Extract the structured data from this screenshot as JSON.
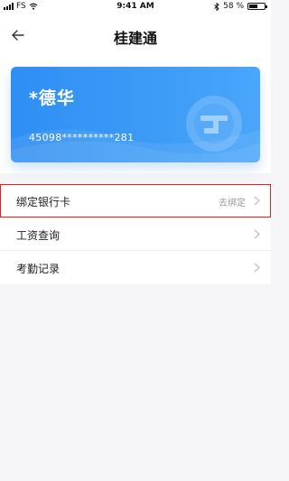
{
  "status_bar": {
    "carrier": "FS",
    "time": "9:41 AM",
    "battery": "58 %",
    "battery_level": 0.58
  },
  "nav": {
    "title": "桂建通"
  },
  "card": {
    "name": "*德华",
    "id_masked": "45098**********281"
  },
  "menu": {
    "items": [
      {
        "label": "绑定银行卡",
        "value": "去绑定"
      },
      {
        "label": "工资查询",
        "value": ""
      },
      {
        "label": "考勤记录",
        "value": ""
      }
    ]
  }
}
